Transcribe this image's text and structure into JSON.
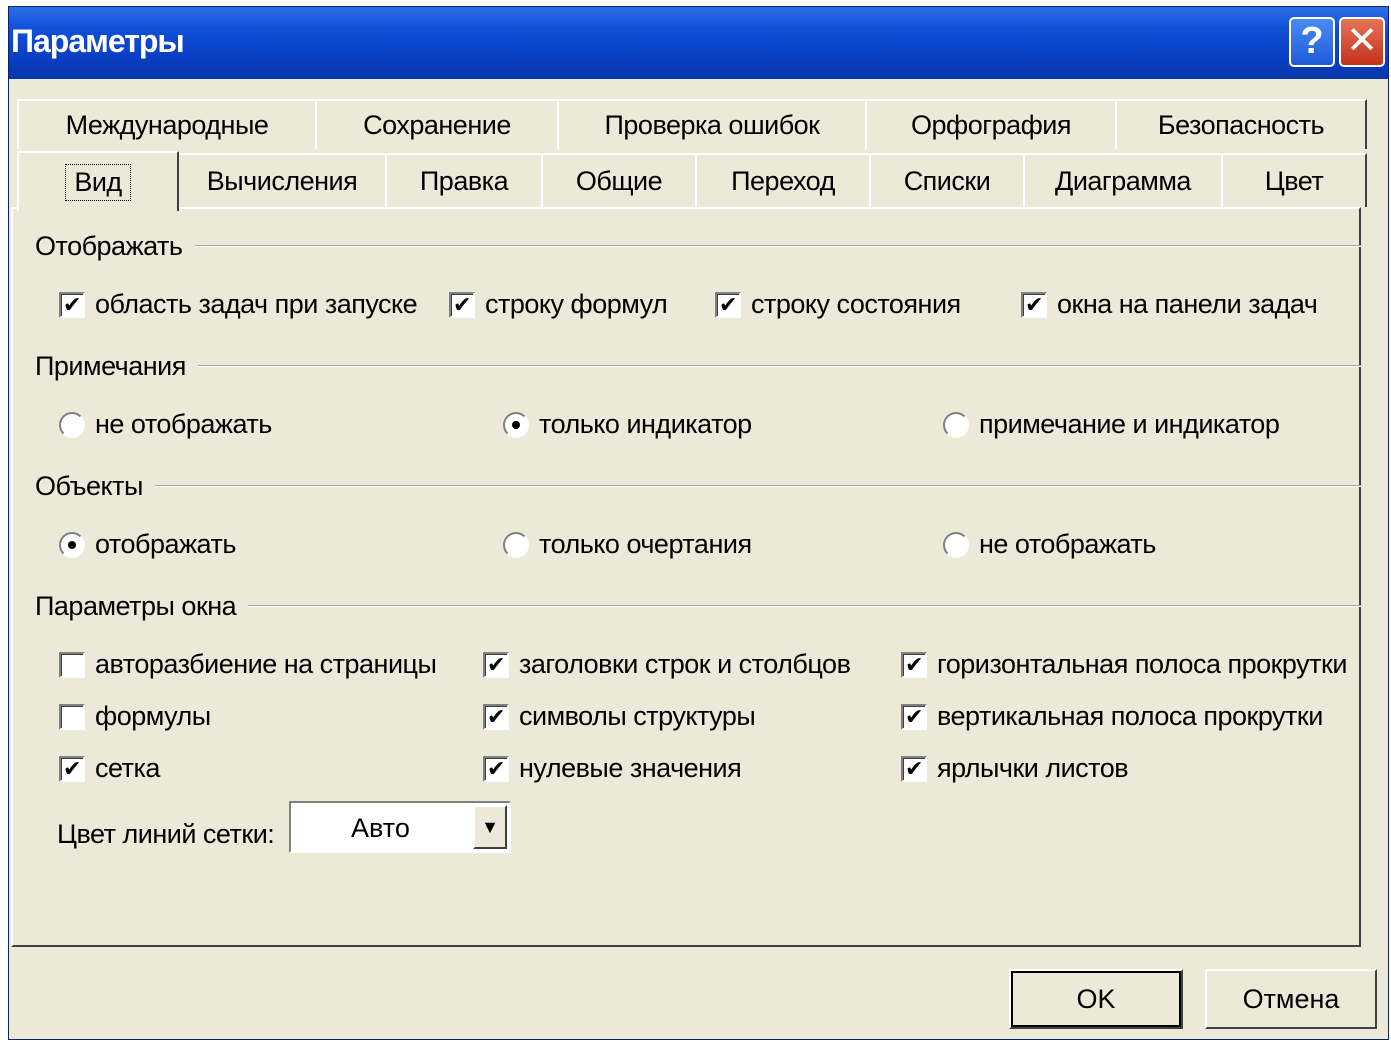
{
  "window": {
    "title": "Параметры"
  },
  "titlebar": {
    "help_label": "?",
    "close_label": "✕"
  },
  "tabs_row1": [
    "Международные",
    "Сохранение",
    "Проверка ошибок",
    "Орфография",
    "Безопасность"
  ],
  "tabs_row2": [
    "Вид",
    "Вычисления",
    "Правка",
    "Общие",
    "Переход",
    "Списки",
    "Диаграмма",
    "Цвет"
  ],
  "active_tab": "Вид",
  "groups": {
    "display": {
      "title": "Отображать",
      "options": [
        {
          "label": "область задач при запуске",
          "checked": true
        },
        {
          "label": "строку формул",
          "checked": true
        },
        {
          "label": "строку состояния",
          "checked": true
        },
        {
          "label": "окна на панели задач",
          "checked": true
        }
      ]
    },
    "comments": {
      "title": "Примечания",
      "options": [
        {
          "label": "не отображать",
          "selected": false
        },
        {
          "label": "только индикатор",
          "selected": true
        },
        {
          "label": "примечание и индикатор",
          "selected": false
        }
      ]
    },
    "objects": {
      "title": "Объекты",
      "options": [
        {
          "label": "отображать",
          "selected": true
        },
        {
          "label": "только очертания",
          "selected": false
        },
        {
          "label": "не отображать",
          "selected": false
        }
      ]
    },
    "window": {
      "title": "Параметры окна",
      "options": [
        {
          "label": "авторазбиение на страницы",
          "checked": false
        },
        {
          "label": "заголовки строк и столбцов",
          "checked": true
        },
        {
          "label": "горизонтальная полоса прокрутки",
          "checked": true
        },
        {
          "label": "формулы",
          "checked": false
        },
        {
          "label": "символы структуры",
          "checked": true
        },
        {
          "label": "вертикальная полоса прокрутки",
          "checked": true
        },
        {
          "label": "сетка",
          "checked": true
        },
        {
          "label": "нулевые значения",
          "checked": true
        },
        {
          "label": "ярлычки листов",
          "checked": true
        }
      ]
    }
  },
  "gridline_color": {
    "label": "Цвет линий сетки:",
    "value": "Авто"
  },
  "buttons": {
    "ok": "OK",
    "cancel": "Отмена"
  }
}
